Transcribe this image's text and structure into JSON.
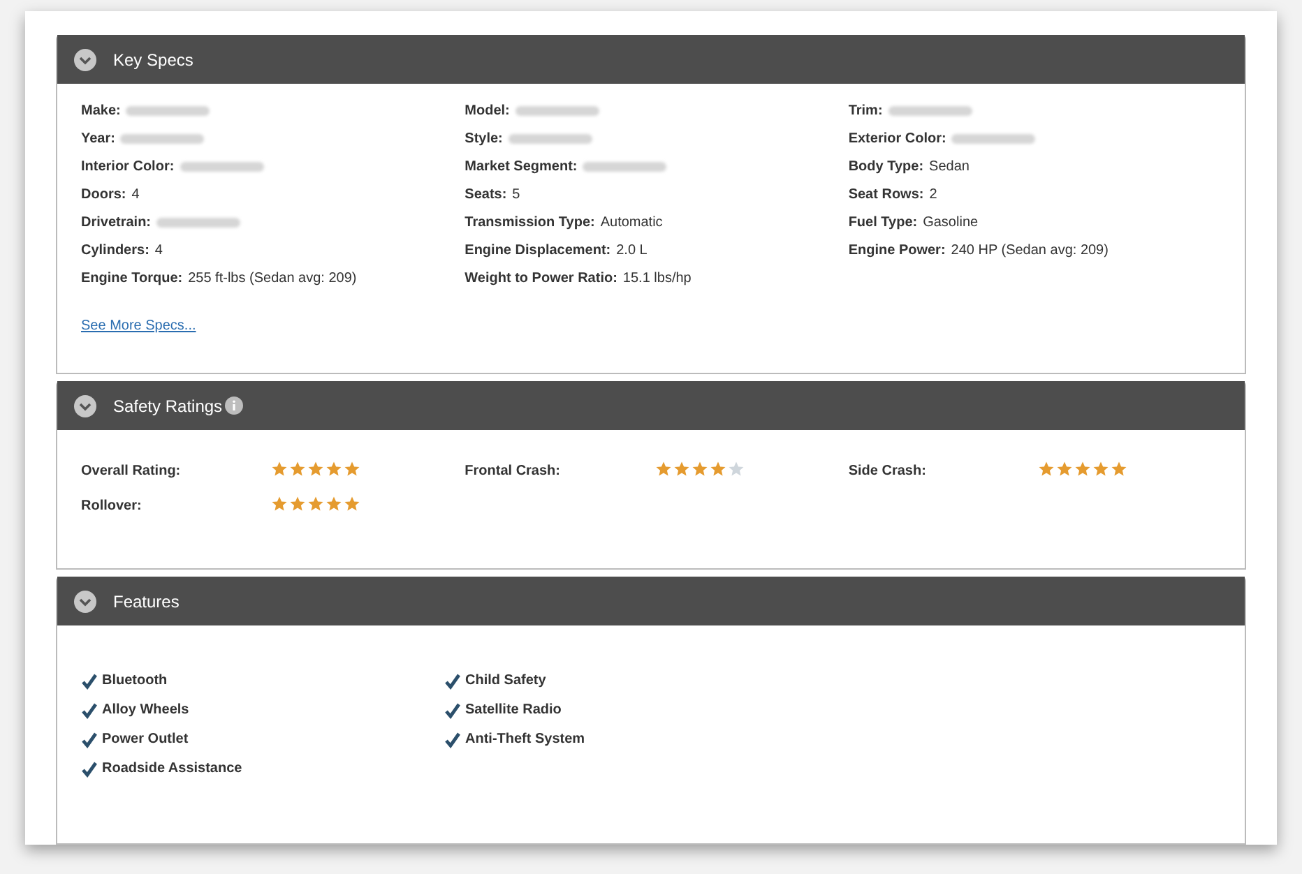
{
  "key_specs": {
    "title": "Key Specs",
    "expanded": true,
    "specs": [
      {
        "label": "Make:",
        "kind": "blurred"
      },
      {
        "label": "Model:",
        "kind": "blurred"
      },
      {
        "label": "Trim:",
        "kind": "blurred"
      },
      {
        "label": "Year:",
        "kind": "blurred"
      },
      {
        "label": "Style:",
        "kind": "blurred"
      },
      {
        "label": "Exterior Color:",
        "kind": "blurred"
      },
      {
        "label": "Interior Color:",
        "kind": "blurred"
      },
      {
        "label": "Market Segment:",
        "kind": "blurred"
      },
      {
        "label": "Body Type:",
        "value": "Sedan",
        "kind": "text"
      },
      {
        "label": "Doors:",
        "value": "4",
        "kind": "text"
      },
      {
        "label": "Seats:",
        "value": "5",
        "kind": "text"
      },
      {
        "label": "Seat Rows:",
        "value": "2",
        "kind": "text"
      },
      {
        "label": "Drivetrain:",
        "kind": "blurred"
      },
      {
        "label": "Transmission Type:",
        "value": "Automatic",
        "kind": "text"
      },
      {
        "label": "Fuel Type:",
        "value": "Gasoline",
        "kind": "text"
      },
      {
        "label": "Cylinders:",
        "value": "4",
        "kind": "text"
      },
      {
        "label": "Engine Displacement:",
        "value": "2.0 L",
        "kind": "text"
      },
      {
        "label": "Engine Power:",
        "value": "240 HP (Sedan avg: 209)",
        "kind": "text"
      },
      {
        "label": "Engine Torque:",
        "value": "255 ft-lbs (Sedan avg: 209)",
        "kind": "text"
      },
      {
        "label": "Weight to Power Ratio:",
        "value": "15.1 lbs/hp",
        "kind": "text"
      }
    ],
    "link": "See More Specs..."
  },
  "safety_ratings": {
    "title": "Safety Ratings",
    "expanded": true,
    "ratings": [
      {
        "label": "Overall Rating:",
        "stars": 5
      },
      {
        "label": "Frontal Crash:",
        "stars": 4
      },
      {
        "label": "Side Crash:",
        "stars": 5
      },
      {
        "label": "Rollover:",
        "stars": 5
      }
    ]
  },
  "features": {
    "title": "Features",
    "expanded": true,
    "items": [
      {
        "label": "Bluetooth",
        "checked": true
      },
      {
        "label": "Child Safety",
        "checked": true
      },
      {
        "label": "Alloy Wheels",
        "checked": true
      },
      {
        "label": "Satellite Radio",
        "checked": true
      },
      {
        "label": "Power Outlet",
        "checked": true
      },
      {
        "label": "Anti-Theft System",
        "checked": true
      },
      {
        "label": "Roadside Assistance",
        "checked": true
      }
    ]
  }
}
